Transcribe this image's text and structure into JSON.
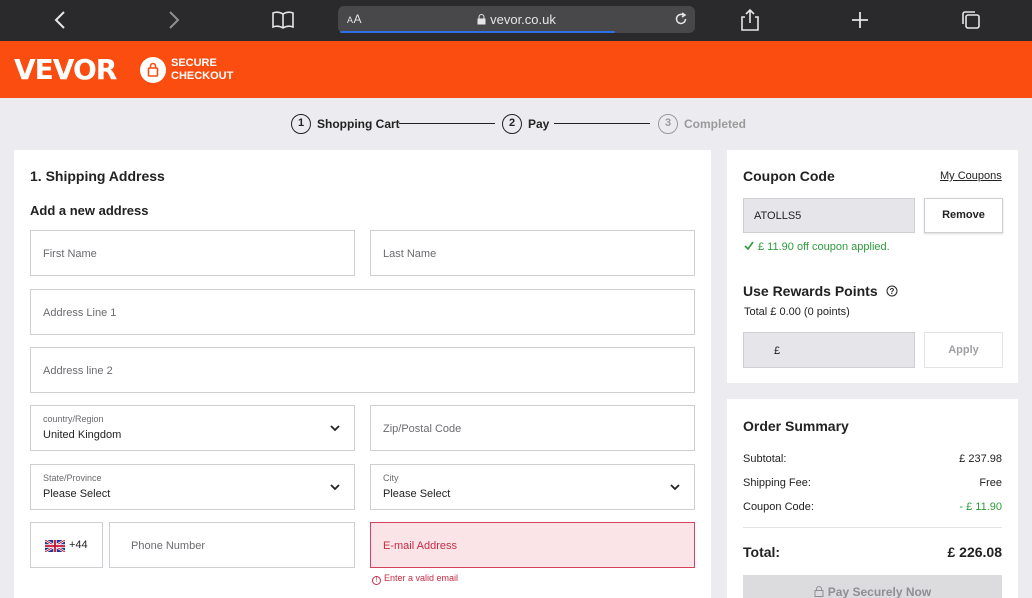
{
  "browser": {
    "aa_label": "AA",
    "url": "vevor.co.uk"
  },
  "brand": {
    "logo": "VEVOR",
    "secure_line1": "SECURE",
    "secure_line2": "CHECKOUT",
    "color": "#fa4d0f"
  },
  "steps": [
    {
      "num": "1",
      "label": "Shopping Cart"
    },
    {
      "num": "2",
      "label": "Pay"
    },
    {
      "num": "3",
      "label": "Completed"
    }
  ],
  "shipping": {
    "title": "1. Shipping Address",
    "subtitle": "Add a new address",
    "first_name_placeholder": "First Name",
    "last_name_placeholder": "Last Name",
    "address1_placeholder": "Address Line 1",
    "address2_placeholder": "Address line 2",
    "country_label": "country/Region",
    "country_value": "United Kingdom",
    "zip_placeholder": "Zip/Postal Code",
    "state_label": "State/Province",
    "state_value": "Please Select",
    "city_label": "City",
    "city_value": "Please Select",
    "phone_code": "+44",
    "phone_placeholder": "Phone Number",
    "email_placeholder": "E-mail Address",
    "email_error": "Enter a valid email"
  },
  "coupon": {
    "title": "Coupon Code",
    "my_coupons_link": "My Coupons",
    "code_value": "ATOLLS5",
    "remove_button": "Remove",
    "applied_message": "£ 11.90 off coupon applied."
  },
  "rewards": {
    "title": "Use Rewards Points",
    "total_text": "Total  £ 0.00 (0 points)",
    "currency_symbol": "£",
    "apply_button": "Apply"
  },
  "summary": {
    "title": "Order Summary",
    "subtotal_label": "Subtotal:",
    "subtotal_value": "£ 237.98",
    "shipping_label": "Shipping Fee:",
    "shipping_value": "Free",
    "coupon_label": "Coupon Code:",
    "coupon_value": "- £ 11.90",
    "total_label": "Total:",
    "total_value": "£ 226.08",
    "pay_button": "Pay Securely Now"
  }
}
